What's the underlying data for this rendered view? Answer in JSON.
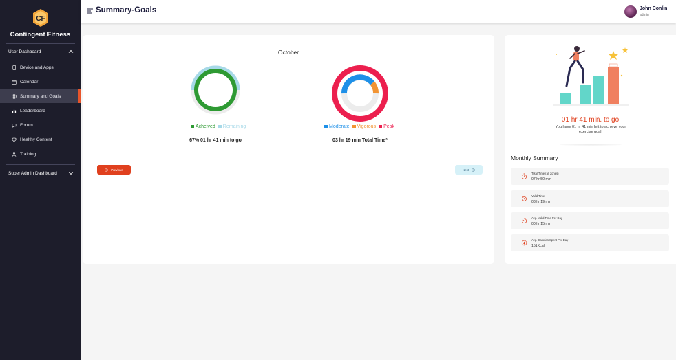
{
  "sidebar": {
    "brand": "Contingent Fitness",
    "sections": [
      {
        "title": "User Dashboard"
      },
      {
        "title": "Super Admin Dashboard"
      }
    ],
    "items": [
      {
        "label": "Device and Apps",
        "icon": "phone-icon"
      },
      {
        "label": "Calendar",
        "icon": "calendar-icon"
      },
      {
        "label": "Summary and Goals",
        "icon": "target-icon",
        "active": true
      },
      {
        "label": "Leaderboard",
        "icon": "bar-chart-icon"
      },
      {
        "label": "Forum",
        "icon": "chat-icon"
      },
      {
        "label": "Healthy Content",
        "icon": "heart-icon"
      },
      {
        "label": "Training",
        "icon": "trainer-icon"
      }
    ]
  },
  "header": {
    "title": "Summary-Goals",
    "user": {
      "name": "John Conlin",
      "role": "admin"
    }
  },
  "main": {
    "month": "October",
    "goal_ring": {
      "legend": [
        {
          "label": "Acheived",
          "color": "#2e9a33"
        },
        {
          "label": "Remaining",
          "color": "#a7d9e8"
        }
      ],
      "caption": "67% 01 hr 41 min to go"
    },
    "zone_ring": {
      "legend": [
        {
          "label": "Moderate",
          "color": "#1e90e8"
        },
        {
          "label": "Vigorous",
          "color": "#f29433"
        },
        {
          "label": "Peak",
          "color": "#ec1f4e"
        }
      ],
      "caption": "03 hr 19 min Total Time*"
    },
    "prev_label": "Previous",
    "next_label": "Next"
  },
  "side": {
    "goal_time": "01 hr 41 min. to go",
    "goal_desc": "You have 01 hr 41 min left to achieve your exercise goal.",
    "monthly_title": "Monthly Summary",
    "stats": [
      {
        "label": "Total Time (all zones)",
        "value": "07 hr 50 min",
        "icon": "stopwatch-icon"
      },
      {
        "label": "Valid Time",
        "value": "03 hr 19 min",
        "icon": "history-icon"
      },
      {
        "label": "Avg. Valid Time Per Day",
        "value": "00 hr 15 min",
        "icon": "timer-icon"
      },
      {
        "label": "Avg. Calories Spent Per Day",
        "value": "151Kcal",
        "icon": "flame-icon"
      }
    ]
  },
  "colors": {
    "accent": "#e0401e",
    "sidebar_bg": "#1d1d2b",
    "next_bg": "#d6f1f8"
  }
}
